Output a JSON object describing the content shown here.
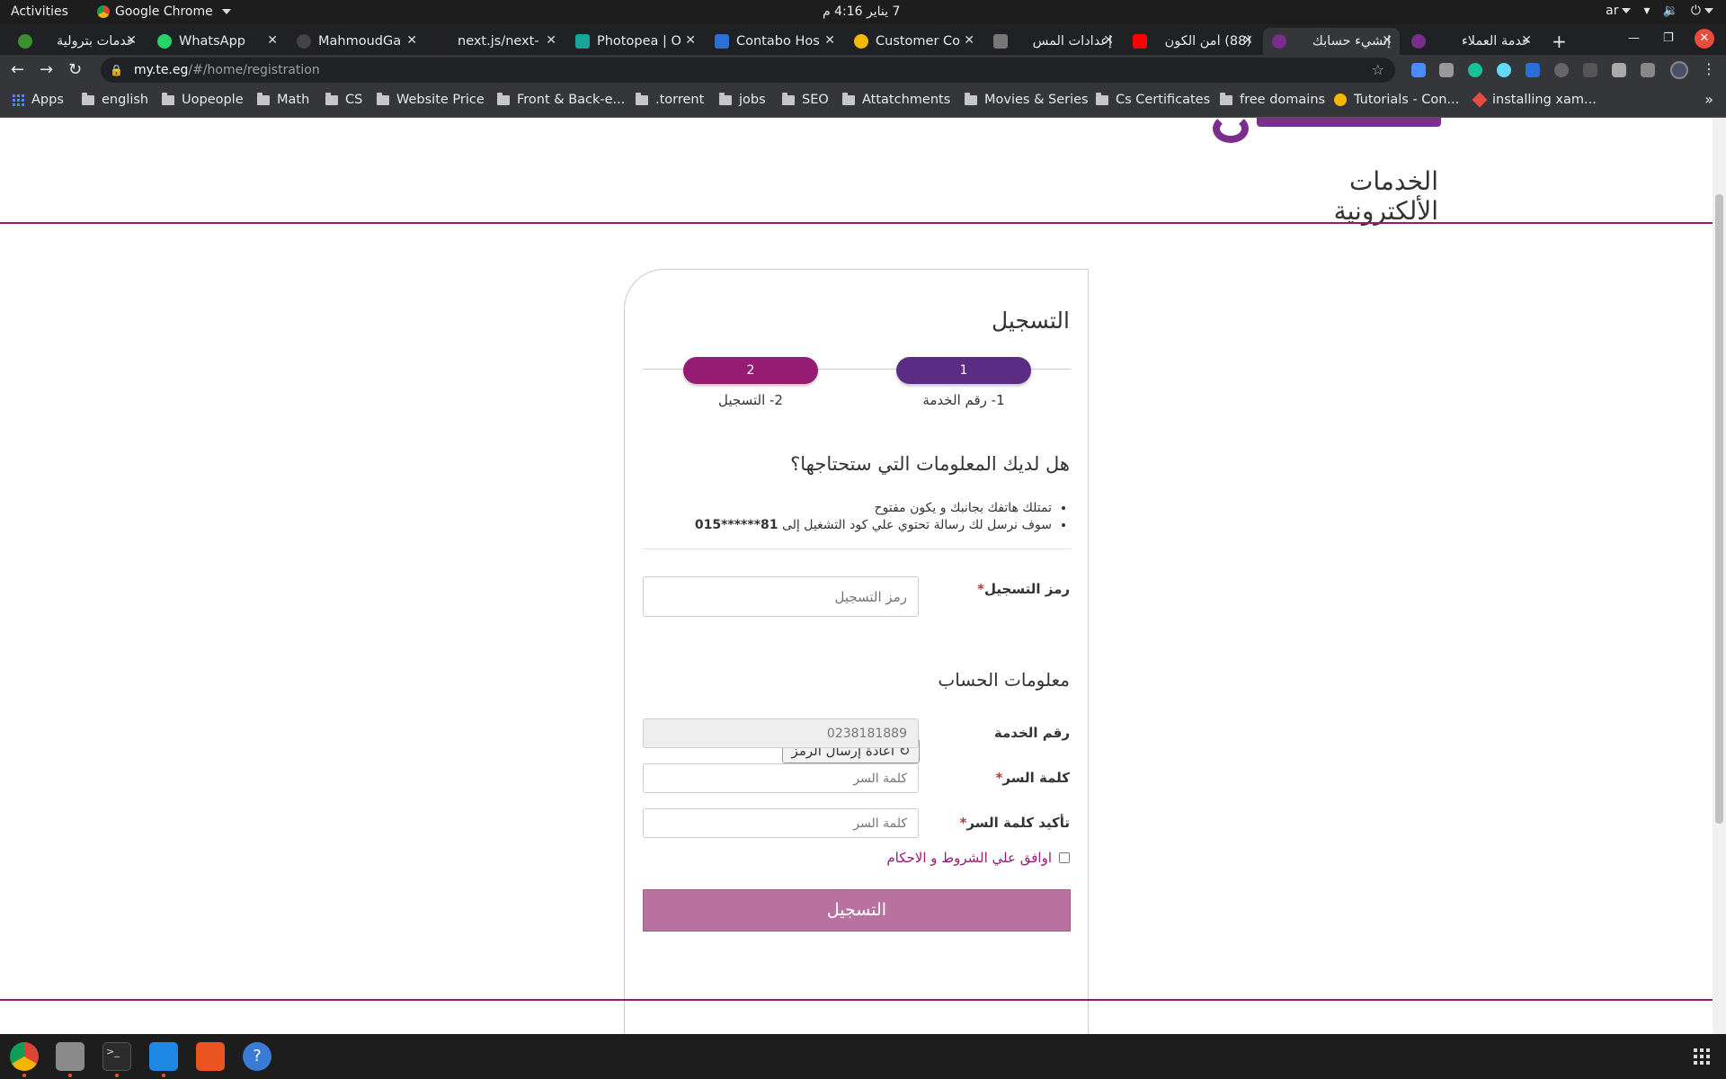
{
  "topbar": {
    "activities": "Activities",
    "app_name": "Google Chrome",
    "clock": "7 يناير  4:16 م",
    "lang": "ar"
  },
  "tabs": [
    {
      "title": "خدمات بترولية",
      "color": "#3b8f2e"
    },
    {
      "title": "WhatsApp",
      "color": "#25d366"
    },
    {
      "title": "MahmoudGa",
      "color": "#444444"
    },
    {
      "title": "next.js/next-",
      "color": "#222222"
    },
    {
      "title": "Photopea | O",
      "color": "#18a497"
    },
    {
      "title": "Contabo Hos",
      "color": "#2d6fd6"
    },
    {
      "title": "Customer Co",
      "color": "#f5b800"
    },
    {
      "title": "إعدادات المس",
      "color": "#777777"
    },
    {
      "title": "(88) أمن الكون",
      "color": "#ff0000"
    },
    {
      "title": "إنشيء حسابك",
      "color": "#7a2d8c"
    },
    {
      "title": "خدمة العملاء",
      "color": "#7a2d8c"
    }
  ],
  "toolbar": {
    "url_host": "my.te.eg",
    "url_path": "/#/home/registration"
  },
  "bookmarks": [
    "Apps",
    "english",
    "Uopeople",
    "Math",
    "CS",
    "Website Price",
    "Front & Back-e...",
    ".torrent",
    "jobs",
    "SEO",
    "Attatchments",
    "Movies & Series",
    "Cs Certificates",
    "free domains",
    "Tutorials - Con...",
    "installing xam..."
  ],
  "page": {
    "service_title": "الخدمات الألكترونية",
    "card_title": "التسجيل",
    "steps": [
      {
        "num": "1",
        "label": "1- رقم الخدمة"
      },
      {
        "num": "2",
        "label": "2- التسجيل"
      }
    ],
    "question": "هل لديك المعلومات التي ستحتاجها؟",
    "requirement_1": "تمتلك هاتفك بجانبك و يكون مفتوح",
    "requirement_2": "سوف نرسل لك رسالة تحتوي علي كود التشغيل إلى",
    "masked_number": "015******81",
    "code_label": "رمز التسجيل",
    "code_placeholder": "رمز التسجيل",
    "resend": "اعادة إرسال الرمز",
    "account_title": "معلومات الحساب",
    "service_number_label": "رقم الخدمة",
    "service_number_value": "0238181889",
    "password_label": "كلمة السر",
    "password_placeholder": "كلمة السر",
    "confirm_label": "تأكيد كلمة السر",
    "confirm_placeholder": "كلمة السر",
    "agree": "اوافق علي الشروط و الاحكام",
    "submit": "التسجيل",
    "accent": "#951b73",
    "step1_color": "#5b2c83"
  }
}
